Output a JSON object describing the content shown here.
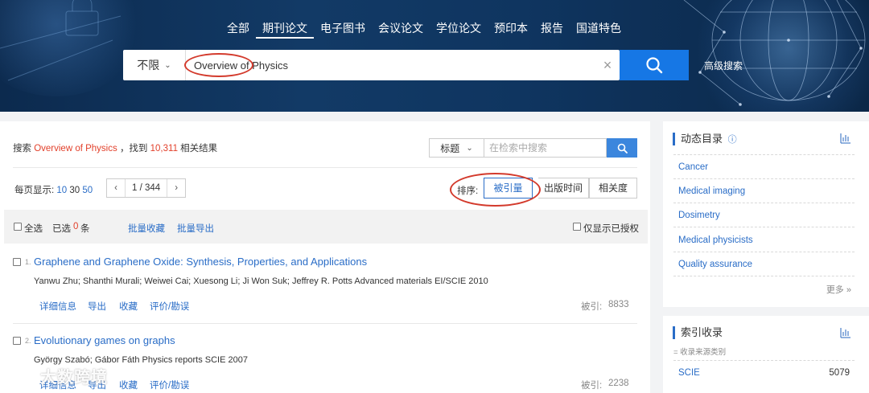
{
  "nav": {
    "tabs": [
      "全部",
      "期刊论文",
      "电子图书",
      "会议论文",
      "学位论文",
      "预印本",
      "报告",
      "国道特色"
    ],
    "active_index": 1
  },
  "search": {
    "scope": "不限",
    "query": "Overview of Physics",
    "advanced_label": "高级搜索"
  },
  "summary": {
    "prefix": "搜索",
    "term": "Overview of Physics",
    "mid": "，找到",
    "count": "10,311",
    "suffix": "相关结果"
  },
  "in_search": {
    "field": "标题",
    "placeholder": "在检索中搜索"
  },
  "paging": {
    "per_page_label": "每页显示:",
    "sizes": [
      "10",
      "30",
      "50"
    ],
    "page_info": "1 / 344"
  },
  "sort": {
    "label": "排序:",
    "options": [
      "被引量",
      "出版时间",
      "相关度"
    ],
    "selected_index": 0
  },
  "toolbar": {
    "select_all": "全选",
    "selected_prefix": "已选",
    "selected_count": "0",
    "selected_suffix": "条",
    "batch_collect": "批量收藏",
    "batch_export": "批量导出",
    "authorized_only": "仅显示已授权"
  },
  "results": [
    {
      "num": "1.",
      "title": "Graphene and Graphene Oxide: Synthesis, Properties, and Applications",
      "authors": "Yanwu Zhu; Shanthi Murali; Weiwei Cai; Xuesong Li; Ji Won Suk; Jeffrey R. Potts Advanced materials EI/SCIE 2010",
      "actions": [
        "详细信息",
        "导出",
        "收藏",
        "评价/勘误"
      ],
      "cite_label": "被引:",
      "cite_count": "8833"
    },
    {
      "num": "2.",
      "title": "Evolutionary games on graphs",
      "authors": "György Szabó; Gábor Fáth Physics reports SCIE 2007",
      "actions": [
        "详细信息",
        "导出",
        "收藏",
        "评价/勘误"
      ],
      "cite_label": "被引:",
      "cite_count": "2238"
    }
  ],
  "sidebar": {
    "dynamic": {
      "title": "动态目录",
      "items": [
        "Cancer",
        "Medical imaging",
        "Dosimetry",
        "Medical physicists",
        "Quality assurance"
      ],
      "more": "更多"
    },
    "index": {
      "title": "索引收录",
      "subtitle": "= 收录来源类别",
      "items": [
        {
          "name": "SCIE",
          "count": "5079"
        }
      ]
    }
  },
  "watermark": "大数跨境",
  "colors": {
    "accent": "#2a6dc7",
    "search_button": "#1677e5",
    "highlight_red": "#e2402b",
    "annotation_oval": "#d33a2c"
  }
}
